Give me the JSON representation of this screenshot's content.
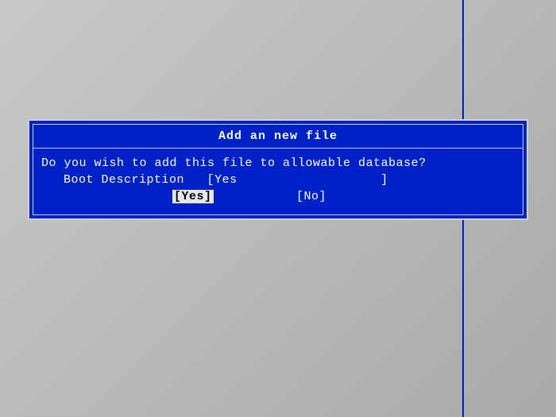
{
  "dialog": {
    "title": "Add an new file",
    "prompt": "Do you wish to add this file to allowable database?",
    "field_label": "Boot Description",
    "input_open": "[",
    "input_value": "Yes",
    "input_close": "]",
    "button_yes": "[Yes]",
    "button_no": "[No]",
    "spacing_desc": "   ",
    "spacing_input_pad": "                   ",
    "spacing_buttons": "           "
  }
}
